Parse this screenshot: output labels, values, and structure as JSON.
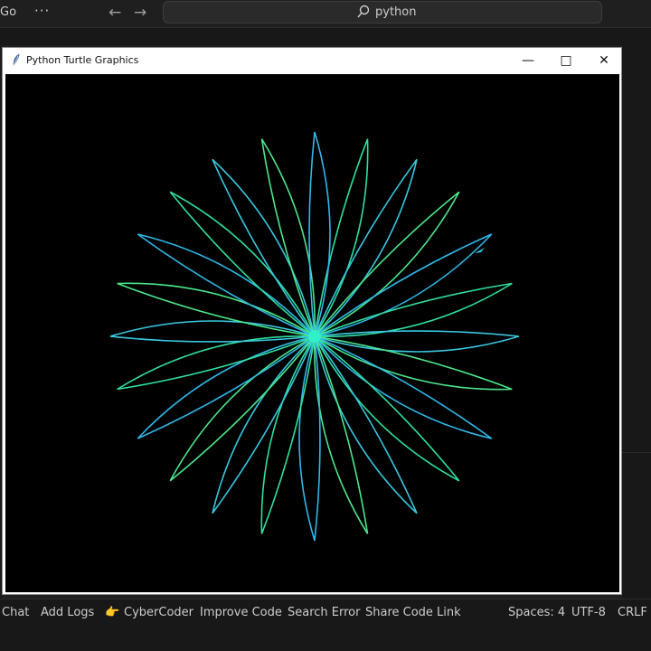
{
  "vscode": {
    "menu_go": "Go",
    "menu_more": "···",
    "nav_back": "←",
    "nav_forward": "→",
    "search_text": "python"
  },
  "turtle_window": {
    "title": "Python Turtle Graphics",
    "minimize": "—",
    "maximize": "□",
    "close": "✕"
  },
  "statusbar": {
    "chat": "Chat",
    "add_logs": "Add Logs",
    "cybercoder_icon": "👉",
    "cybercoder": "CyberCoder",
    "improve_code": "Improve Code",
    "search_error": "Search Error",
    "share_code_link": "Share Code Link",
    "spaces": "Spaces: 4",
    "encoding": "UTF-8",
    "line_ending": "CRLF"
  },
  "drawing": {
    "petal_count": 24,
    "colors": [
      "#2fe0a0",
      "#38c8e0",
      "#4ce68a",
      "#30b8e8"
    ],
    "background": "#000000"
  }
}
